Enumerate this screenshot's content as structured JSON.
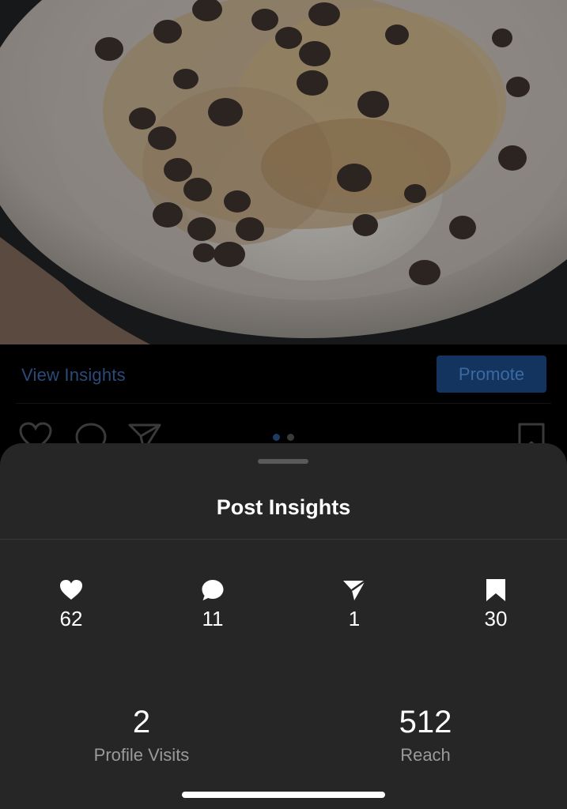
{
  "post_actions": {
    "view_insights_label": "View Insights",
    "promote_label": "Promote",
    "carousel_dots": 2,
    "carousel_active_index": 0
  },
  "insights_sheet": {
    "title": "Post Insights",
    "metrics": [
      {
        "icon": "heart-icon",
        "value": "62"
      },
      {
        "icon": "comment-icon",
        "value": "11"
      },
      {
        "icon": "share-icon",
        "value": "1"
      },
      {
        "icon": "bookmark-icon",
        "value": "30"
      }
    ],
    "stats": [
      {
        "value": "2",
        "label": "Profile Visits"
      },
      {
        "value": "512",
        "label": "Reach"
      }
    ]
  },
  "colors": {
    "sheet_background": "#262626",
    "link_dimmed": "#2a4a78",
    "promote_dimmed": "#12345f",
    "secondary_text": "#9a9a9a"
  }
}
